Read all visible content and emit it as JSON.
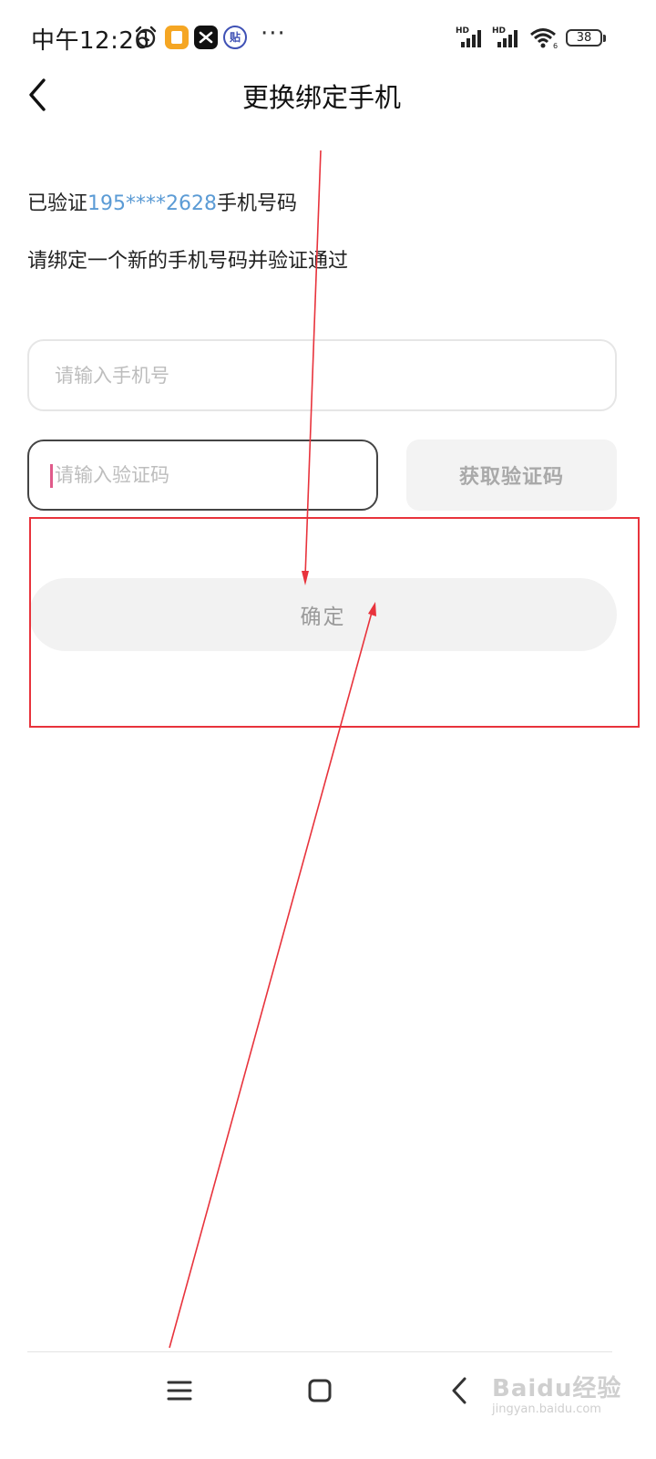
{
  "status_bar": {
    "time": "中午12:26",
    "more": "···",
    "signal_label_1": "HD",
    "signal_label_2": "HD",
    "battery": "38",
    "icons": [
      "alarm-clock-icon",
      "orange-app-icon",
      "capcut-icon",
      "tieba-icon",
      "signal-icon",
      "wifi-icon",
      "battery-icon"
    ],
    "colors": {
      "orange_app": "#f5a623",
      "capcut": "#111111",
      "tieba": "#3f51b5"
    }
  },
  "header": {
    "back_icon": "chevron-left-icon",
    "title": "更换绑定手机"
  },
  "info": {
    "verified_prefix": "已验证",
    "verified_phone": "195****2628",
    "verified_suffix": "手机号码",
    "instruction": "请绑定一个新的手机号码并验证通过"
  },
  "form": {
    "phone_placeholder": "请输入手机号",
    "phone_value": "",
    "code_placeholder": "请输入验证码",
    "code_value": "",
    "get_code_label": "获取验证码",
    "confirm_label": "确定"
  },
  "nav": {
    "icons": [
      "menu-icon",
      "home-square-icon",
      "back-chevron-icon"
    ]
  },
  "watermark": {
    "text": "Baidu经验",
    "sub": "jingyan.baidu.com"
  },
  "colors": {
    "accent_phone": "#5b9bd5",
    "annotation_red": "#e8333c",
    "cursor_pink": "#e05a8a"
  }
}
